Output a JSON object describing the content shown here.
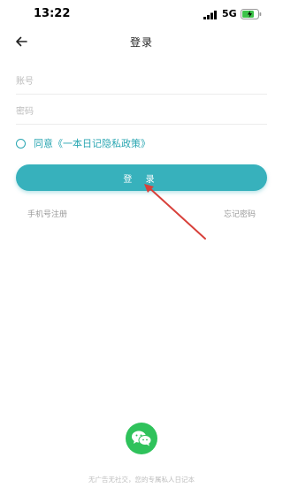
{
  "status_bar": {
    "time": "13:22",
    "network": "5G"
  },
  "header": {
    "title": "登录"
  },
  "form": {
    "account_placeholder": "账号",
    "password_placeholder": "密码",
    "agreement_text": "同意《一本日记隐私政策》",
    "login_label": "登 录"
  },
  "links": {
    "phone_register": "手机号注册",
    "forgot_password": "忘记密码"
  },
  "footer": {
    "text": "无广告无社交，您的专属私人日记本"
  },
  "colors": {
    "accent": "#37b1bc",
    "wechat": "#2fc25b",
    "arrow": "#d8403a"
  },
  "icons": {
    "back": "arrow-left-icon",
    "agree": "radio-icon",
    "wechat": "wechat-icon",
    "signal": "signal-icon",
    "battery": "battery-icon"
  }
}
